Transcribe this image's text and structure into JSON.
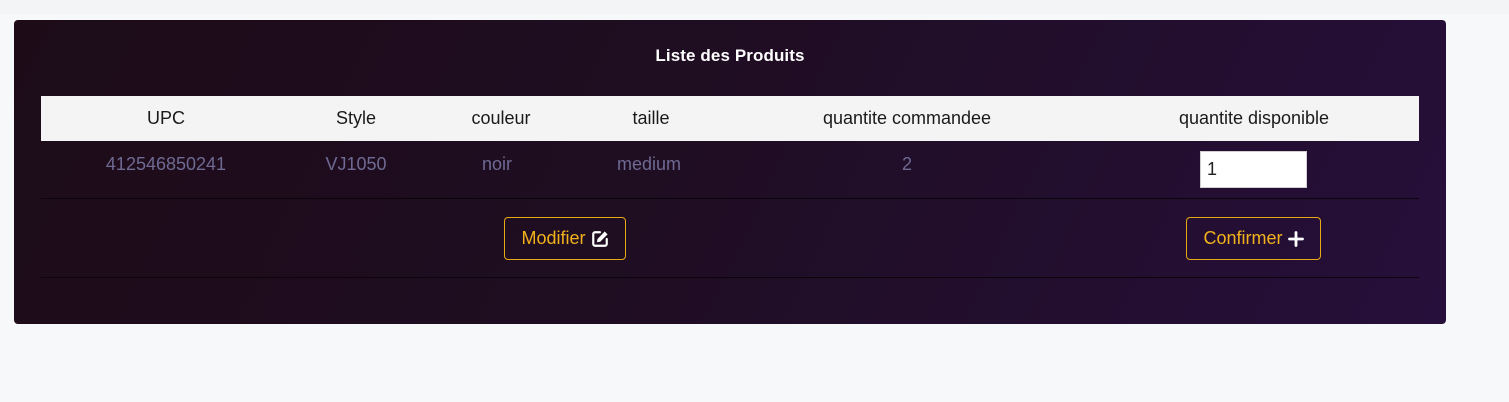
{
  "panel": {
    "title": "Liste des Produits"
  },
  "table": {
    "headers": [
      "UPC",
      "Style",
      "couleur",
      "taille",
      "quantite commandee",
      "quantite disponible"
    ],
    "rows": [
      {
        "upc": "412546850241",
        "style": "VJ1050",
        "couleur": "noir",
        "taille": "medium",
        "quantite_commandee": "2",
        "quantite_disponible": "1"
      }
    ]
  },
  "actions": {
    "modifier_label": "Modifier",
    "modifier_icon": "edit-icon",
    "confirmer_label": "Confirmer",
    "confirmer_icon": "plus-icon"
  },
  "colors": {
    "panel_bg_start": "#1d0c18",
    "panel_bg_end": "#260f3a",
    "accent": "#f1b21c",
    "cell_text": "#6e6a93",
    "header_bg": "#f4f4f4"
  }
}
